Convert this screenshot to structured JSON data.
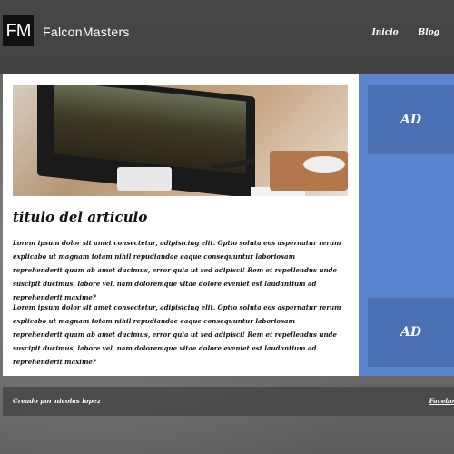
{
  "header": {
    "logo_text": "FM",
    "brand": "FalconMasters",
    "nav": [
      "Inicio",
      "Blog"
    ]
  },
  "main": {
    "title": "titulo del articulo",
    "paragraphs": [
      "Lorem ipsum dolor sit amet consectetur, adipisicing elit. Optio soluta eos aspernatur rerum explicabo ut magnam totam nihil repudiandae eaque consequuntur laboriosam reprehenderit quam ab amet ducimus, error quia ut sed adipisci! Rem et repellendus unde suscipit ducimus, labore vel, nam doloremque vitae dolore eveniet est laudantium ad reprehenderit maxime?",
      "Lorem ipsum dolor sit amet consectetur, adipisicing elit. Optio soluta eos aspernatur rerum explicabo ut magnam totam nihil repudiandae eaque consequuntur laboriosam reprehenderit quam ab amet ducimus, error quia ut sed adipisci! Rem et repellendus unde suscipit ducimus, labore vel, nam doloremque vitae dolore eveniet est laudantium ad reprehenderit maxime?"
    ]
  },
  "sidebar": {
    "ads": [
      "AD",
      "AD"
    ]
  },
  "footer": {
    "credit": "Creado por nicolas lopez",
    "link": "Facebo"
  }
}
